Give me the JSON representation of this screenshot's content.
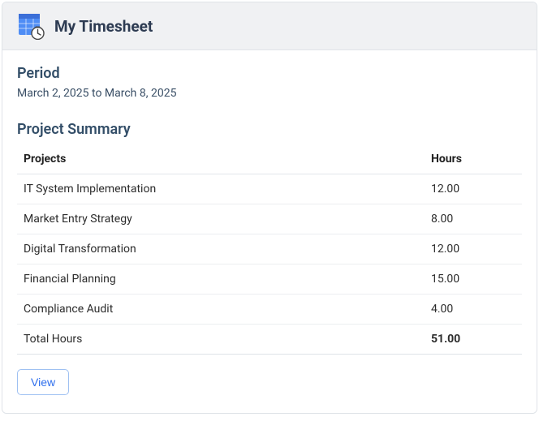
{
  "header": {
    "title": "My Timesheet"
  },
  "period": {
    "label": "Period",
    "range_text": "March 2, 2025 to March 8, 2025"
  },
  "summary": {
    "label": "Project Summary",
    "columns": {
      "projects": "Projects",
      "hours": "Hours"
    },
    "rows": [
      {
        "project": "IT System Implementation",
        "hours": "12.00"
      },
      {
        "project": "Market Entry Strategy",
        "hours": "8.00"
      },
      {
        "project": "Digital Transformation",
        "hours": "12.00"
      },
      {
        "project": "Financial Planning",
        "hours": "15.00"
      },
      {
        "project": "Compliance Audit",
        "hours": "4.00"
      }
    ],
    "total": {
      "label": "Total Hours",
      "value": "51.00"
    }
  },
  "actions": {
    "view_label": "View"
  },
  "icons": {
    "timesheet": "timesheet-icon"
  }
}
